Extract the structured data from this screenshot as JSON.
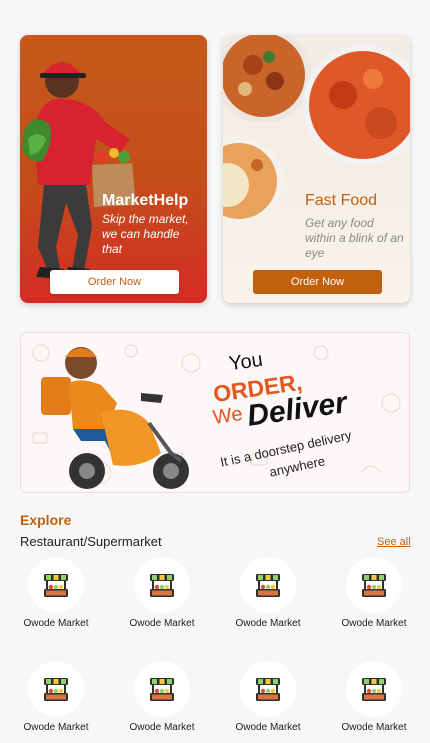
{
  "promos": [
    {
      "title": "MarketHelp",
      "subtitle": "Skip the market, we can handle that",
      "button": "Order Now"
    },
    {
      "title": "Fast Food",
      "subtitle": "Get any food within a blink of an eye",
      "button": "Order Now"
    }
  ],
  "banner": {
    "line1": "You",
    "line2": "ORDER,",
    "line3a": "We",
    "line3b": "Deliver",
    "line4": "It is a doorstep delivery",
    "line5": "anywhere"
  },
  "explore": {
    "title": "Explore",
    "section": "Restaurant/Supermarket",
    "see_all": "See all",
    "stores": [
      {
        "label": "Owode Market",
        "icon": "market-stall-icon"
      },
      {
        "label": "Owode Market",
        "icon": "market-stall-icon"
      },
      {
        "label": "Owode Market",
        "icon": "market-stall-icon"
      },
      {
        "label": "Owode Market",
        "icon": "market-stall-icon"
      },
      {
        "label": "Owode Market",
        "icon": "market-stall-icon"
      },
      {
        "label": "Owode Market",
        "icon": "market-stall-icon"
      },
      {
        "label": "Owode Market",
        "icon": "market-stall-icon"
      },
      {
        "label": "Owode Market",
        "icon": "market-stall-icon"
      }
    ]
  },
  "colors": {
    "brand": "#c3600d",
    "red": "#d42b25",
    "background": "#f7f7f7"
  }
}
